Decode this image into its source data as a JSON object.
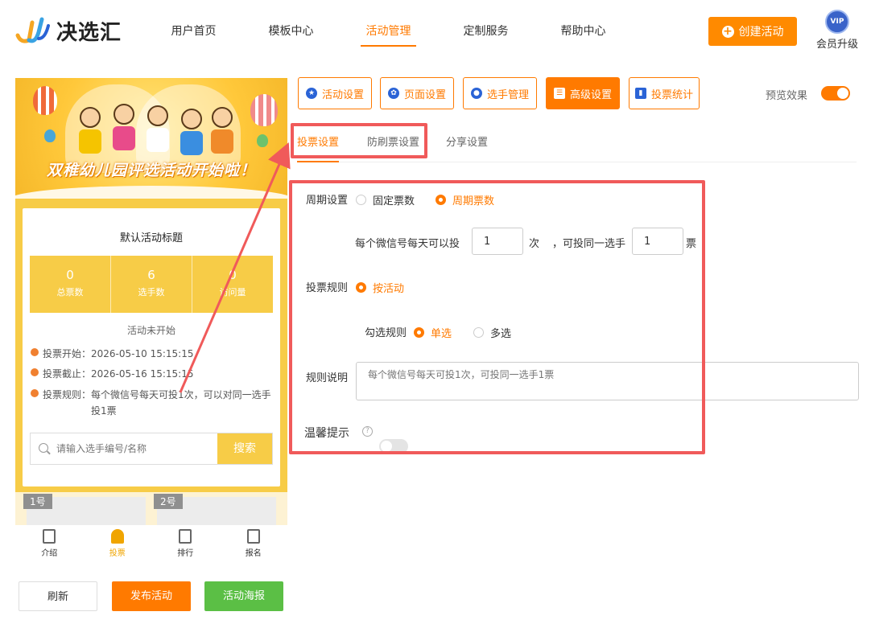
{
  "brand": {
    "name": "决选汇"
  },
  "nav": [
    "用户首页",
    "模板中心",
    "活动管理",
    "定制服务",
    "帮助中心"
  ],
  "header": {
    "create_label": "创建活动",
    "vip_badge": "VIP",
    "vip_label": "会员升级"
  },
  "preview": {
    "banner_title": "双稚幼儿园评选活动开始啦！",
    "activity_title": "默认活动标题",
    "stats": [
      {
        "value": "0",
        "label": "总票数"
      },
      {
        "value": "6",
        "label": "选手数"
      },
      {
        "value": "0",
        "label": "访问量"
      }
    ],
    "status": "活动未开始",
    "info": [
      {
        "key": "投票开始：",
        "value": "2026-05-10 15:15:15"
      },
      {
        "key": "投票截止：",
        "value": "2026-05-16 15:15:15"
      },
      {
        "key": "投票规则：",
        "value": "每个微信号每天可投1次，可以对同一选手投1票"
      }
    ],
    "search_placeholder": "请输入选手编号/名称",
    "search_button": "搜索",
    "players": [
      "1号",
      "2号"
    ],
    "tabs": [
      "介绍",
      "投票",
      "排行",
      "报名"
    ]
  },
  "actions": {
    "refresh": "刷新",
    "publish": "发布活动",
    "poster": "活动海报"
  },
  "toolbar": {
    "buttons": [
      "活动设置",
      "页面设置",
      "选手管理",
      "高级设置",
      "投票统计"
    ],
    "preview_label": "预览效果"
  },
  "subtabs": [
    "投票设置",
    "防刷票设置",
    "分享设置"
  ],
  "form": {
    "period_label": "周期设置",
    "period_options": [
      "固定票数",
      "周期票数"
    ],
    "per_day_text": "每个微信号每天可以投",
    "per_day_value": "1",
    "times_unit": "次",
    "same_player_text": "，可投同一选手",
    "same_player_value": "1",
    "votes_unit": "票",
    "rule_label": "投票规则",
    "rule_option": "按活动",
    "check_label": "勾选规则",
    "check_options": [
      "单选",
      "多选"
    ],
    "desc_label": "规则说明",
    "desc_placeholder": "每个微信号每天可投1次，可投同一选手1票",
    "tip_label": "温馨提示",
    "help_glyph": "?"
  },
  "colors": {
    "accent": "#ff7a00",
    "annotation": "#f05a5a",
    "yellow": "#f7cc47",
    "green": "#5bbf45"
  }
}
